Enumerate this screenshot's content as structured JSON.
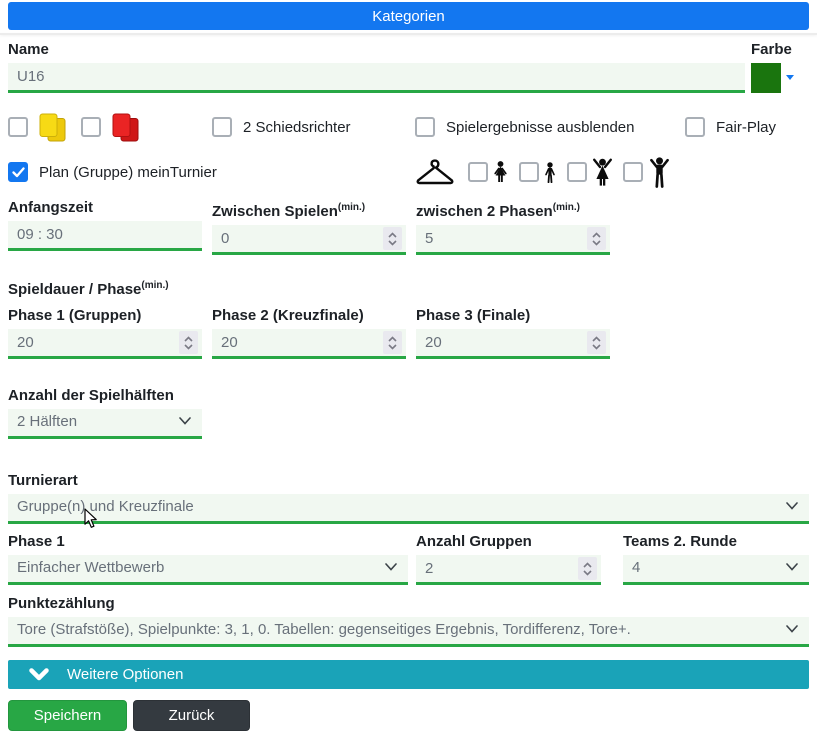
{
  "colors": {
    "header_blue": "#1377f0",
    "accent_green": "#28a745",
    "field_bg": "#f1f8f1",
    "teal_bar": "#1aa3b8",
    "save_green": "#28a745",
    "back_dark": "#343a40",
    "farbe_swatch": "#1a750e",
    "checked_blue": "#1377f0"
  },
  "icons": {
    "farbe_dropdown": "triangle-down-blue",
    "yellow_cards": "two-overlapping-yellow-cards",
    "red_cards": "two-overlapping-red-cards",
    "hanger": "clothes-hanger-outline",
    "girl": "small-girl-silhouette",
    "boy": "small-boy-silhouette",
    "woman": "woman-arms-up-silhouette",
    "man": "man-arms-up-silhouette",
    "stepper": "up-down-chevrons",
    "select_chevron": "chevron-down",
    "expander_chevron": "bold-chevron-down-white",
    "checkmark": "white-check",
    "cursor": "mouse-pointer-arrow"
  },
  "header": {
    "title": "Kategorien"
  },
  "name": {
    "label": "Name",
    "value": "U16"
  },
  "farbe": {
    "label": "Farbe"
  },
  "penalty_cards": {
    "yellow_checked": false,
    "red_checked": false
  },
  "options": {
    "schiedsrichter": "2 Schiedsrichter",
    "spielergebnisse": "Spielergebnisse ausblenden",
    "fairplay": "Fair-Play",
    "plan": "Plan (Gruppe) meinTurnier",
    "plan_checked": true,
    "age_groups_checked": [
      false,
      false,
      false,
      false
    ]
  },
  "timing": {
    "anfangszeit": {
      "label": "Anfangszeit",
      "value": "09 : 30"
    },
    "zwischen_spielen": {
      "label": "Zwischen Spielen",
      "sup": "(min.)",
      "value": "0"
    },
    "zwischen_phasen": {
      "label": "zwischen 2 Phasen",
      "sup": "(min.)",
      "value": "5"
    }
  },
  "spieldauer": {
    "label": "Spieldauer / Phase",
    "sup": "(min.)",
    "phases": [
      {
        "label": "Phase 1 (Gruppen)",
        "value": "20"
      },
      {
        "label": "Phase 2 (Kreuzfinale)",
        "value": "20"
      },
      {
        "label": "Phase 3 (Finale)",
        "value": "20"
      }
    ]
  },
  "spielhaelften": {
    "label": "Anzahl der Spielhälften",
    "value": "2 Hälften"
  },
  "turnierart": {
    "label": "Turnierart",
    "value": "Gruppe(n) und Kreuzfinale"
  },
  "phase_row": {
    "phase1": {
      "label": "Phase 1",
      "value": "Einfacher Wettbewerb"
    },
    "anzahl_gruppen": {
      "label": "Anzahl Gruppen",
      "value": "2"
    },
    "teams_runde": {
      "label": "Teams 2. Runde",
      "value": "4"
    }
  },
  "punkte": {
    "label": "Punktezählung",
    "value": "Tore (Strafstöße), Spielpunkte: 3, 1, 0. Tabellen: gegenseitiges Ergebnis, Tordifferenz, Tore+."
  },
  "weitere": {
    "label": "Weitere Optionen"
  },
  "actions": {
    "save": "Speichern",
    "back": "Zurück"
  }
}
